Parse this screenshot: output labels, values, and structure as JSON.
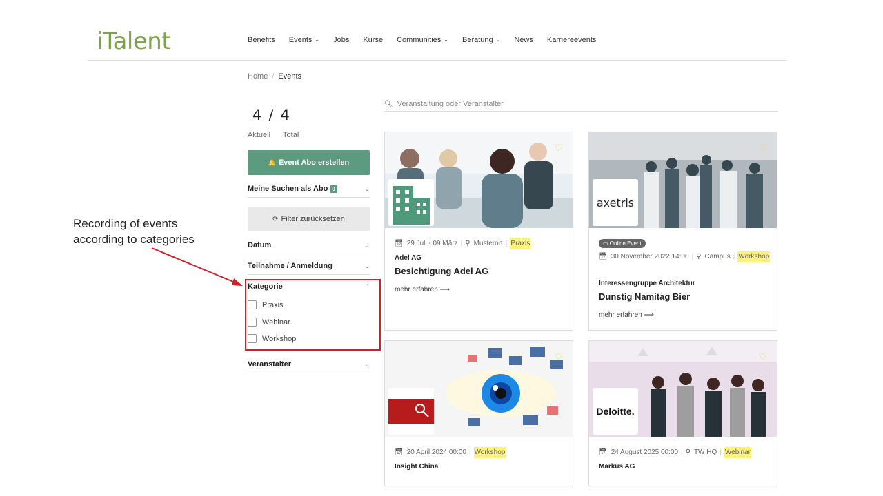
{
  "logo": "iTalent",
  "nav": [
    {
      "label": "Benefits",
      "chev": false
    },
    {
      "label": "Events",
      "chev": true
    },
    {
      "label": "Jobs",
      "chev": false
    },
    {
      "label": "Kurse",
      "chev": false
    },
    {
      "label": "Communities",
      "chev": true
    },
    {
      "label": "Beratung",
      "chev": true
    },
    {
      "label": "News",
      "chev": false
    },
    {
      "label": "Karriereevents",
      "chev": false
    }
  ],
  "breadcrumb": {
    "home": "Home",
    "sep": "/",
    "current": "Events"
  },
  "counts": {
    "current": "4",
    "slash": "/",
    "total": "4",
    "current_label": "Aktuell",
    "total_label": "Total"
  },
  "abo_button": "Event Abo erstellen",
  "saved_searches": {
    "label": "Meine Suchen als Abo",
    "count": "0"
  },
  "filter_reset": "Filter zurücksetzen",
  "filters": {
    "datum": "Datum",
    "teilnahme": "Teilnahme / Anmeldung",
    "kategorie": "Kategorie",
    "veranstalter": "Veranstalter",
    "categories": [
      "Praxis",
      "Webinar",
      "Workshop"
    ]
  },
  "annotation": "Recording of events according to categories",
  "search": {
    "placeholder": "Veranstaltung oder Veranstalter"
  },
  "cards": [
    {
      "date": "29 Juli - 09 März",
      "location": "Musterort",
      "category": "Praxis",
      "org": "Adel AG",
      "title": "Besichtigung Adel AG",
      "more": "mehr erfahren"
    },
    {
      "online": "Online Event",
      "logo_text": "axetris",
      "date": "30 November 2022 14:00",
      "location": "Campus",
      "category": "Workshop",
      "org": "Interessengruppe Architektur",
      "title": "Dunstig Namitag Bier",
      "more": "mehr erfahren"
    },
    {
      "date": "20 April 2024 00:00",
      "category": "Workshop",
      "org": "Insight China"
    },
    {
      "logo_text": "Deloitte.",
      "date": "24 August 2025 00:00",
      "location": "TW HQ",
      "category": "Webinar",
      "org": "Markus AG"
    }
  ],
  "colors": {
    "accent": "#5c9b7f",
    "logo": "#7da34a",
    "highlight": "#fff27a",
    "annotation": "#d0202a"
  }
}
